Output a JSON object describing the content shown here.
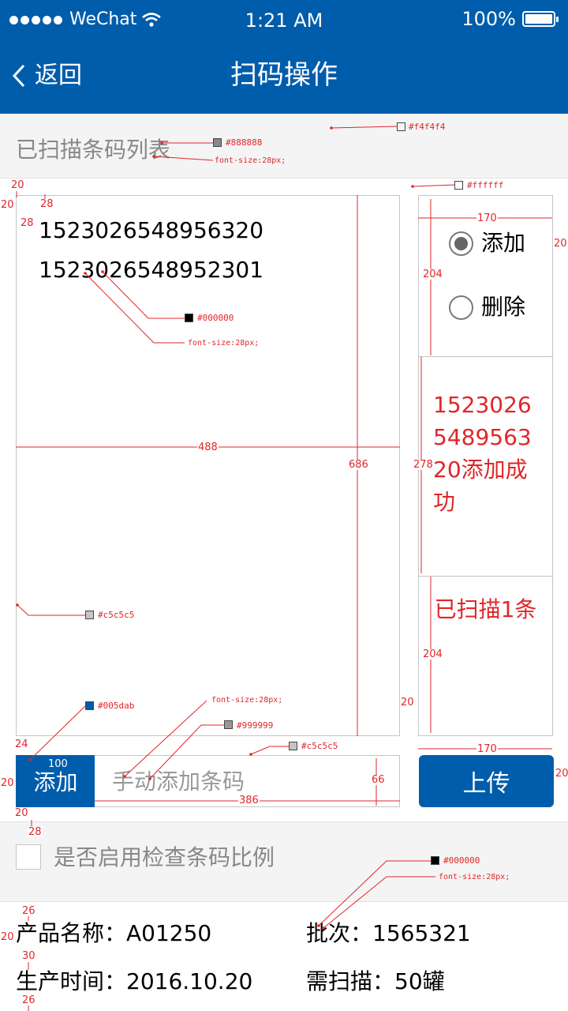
{
  "status_bar": {
    "carrier": "WeChat",
    "time": "1:21 AM",
    "battery": "100%"
  },
  "nav": {
    "back_label": "返回",
    "title": "扫码操作"
  },
  "list_header": {
    "label": "已扫描条码列表"
  },
  "scanned_codes": [
    "1523026548956320",
    "1523026548952301"
  ],
  "mode_panel": {
    "options": [
      {
        "label": "添加",
        "selected": true
      },
      {
        "label": "删除",
        "selected": false
      }
    ],
    "result_message": "1523026548956320添加成功",
    "scan_count": "已扫描1条"
  },
  "manual_add": {
    "button_label": "添加",
    "placeholder": "手动添加条码",
    "value": ""
  },
  "upload": {
    "label": "上传"
  },
  "ratio_check": {
    "label": "是否启用检查条码比例",
    "checked": false
  },
  "product_info": {
    "name_label": "产品名称：",
    "name_value": "A01250",
    "batch_label": "批次：",
    "batch_value": "1565321",
    "date_label": "生产时间：",
    "date_value": "2016.10.20",
    "required_label": "需扫描：",
    "required_value": "50罐"
  },
  "colors": {
    "primary": "#005dab",
    "header_bg": "#f4f4f4",
    "list_text": "#000000",
    "header_label": "#888888",
    "border": "#c5c5c5",
    "placeholder": "#999999",
    "alert": "#e0262a",
    "panel_bg": "#ffffff"
  },
  "annotations": {
    "color_f4f4f4": "#f4f4f4",
    "color_888888": "#888888",
    "font_size_a": "font-size:28px;",
    "color_ffffff": "#ffffff",
    "color_000000_a": "#000000",
    "font_size_b": "font-size:28px;",
    "color_c5c5c5_a": "#c5c5c5",
    "color_005dab": "#005dab",
    "font_size_c": "font-size:28px;",
    "color_999999": "#999999",
    "color_c5c5c5_b": "#c5c5c5",
    "color_000000_b": "#000000",
    "font_size_d": "font-size:28px;",
    "dim_20_a": "20",
    "dim_20_b": "20",
    "dim_28_a": "28",
    "dim_28_b": "28",
    "dim_488": "488",
    "dim_686": "686",
    "dim_170_a": "170",
    "dim_20_c": "20",
    "dim_204_a": "204",
    "dim_278": "278",
    "dim_204_b": "204",
    "dim_20_d": "20",
    "dim_170_b": "170",
    "dim_24": "24",
    "dim_100": "100",
    "dim_20_e": "20",
    "dim_66": "66",
    "dim_386": "386",
    "dim_20_f": "20",
    "dim_20_g": "20",
    "dim_28_c": "28",
    "dim_26_a": "26",
    "dim_20_h": "20",
    "dim_30": "30",
    "dim_26_b": "26"
  }
}
